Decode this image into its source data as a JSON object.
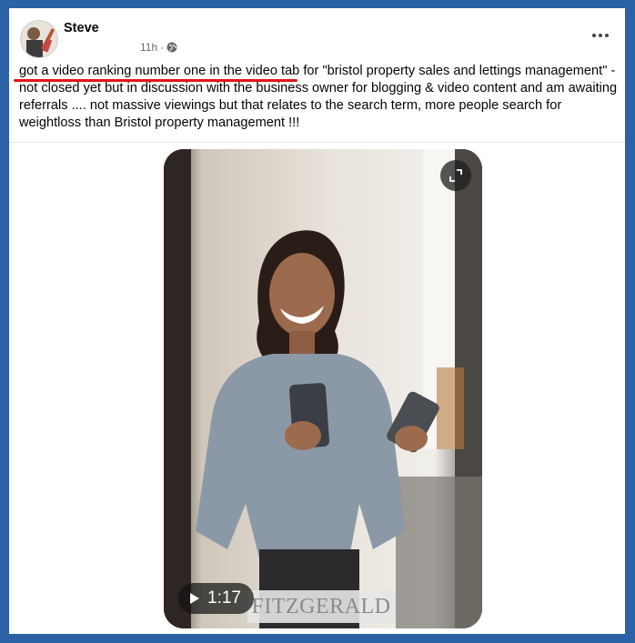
{
  "post": {
    "author": "Steve",
    "time": "11h",
    "separator": "·",
    "text_highlighted": "got a video ranking number one in the video tab",
    "text_rest": " for \"bristol property sales and lettings management\" - not closed yet but in discussion with the business owner for blogging & video content and am awaiting referrals .... not massive viewings but that relates to the search term, more people search for weightloss than Bristol property management !!!",
    "audience_icon": "globe-icon",
    "menu_icon": "more-options-icon"
  },
  "video": {
    "duration": "1:17",
    "watermark": "FITZGERALD",
    "expand_icon": "expand-icon",
    "play_icon": "play-icon"
  },
  "colors": {
    "frame": "#2b63a6",
    "highlight_underline": "#e0151b",
    "secondary_text": "#65676b"
  }
}
